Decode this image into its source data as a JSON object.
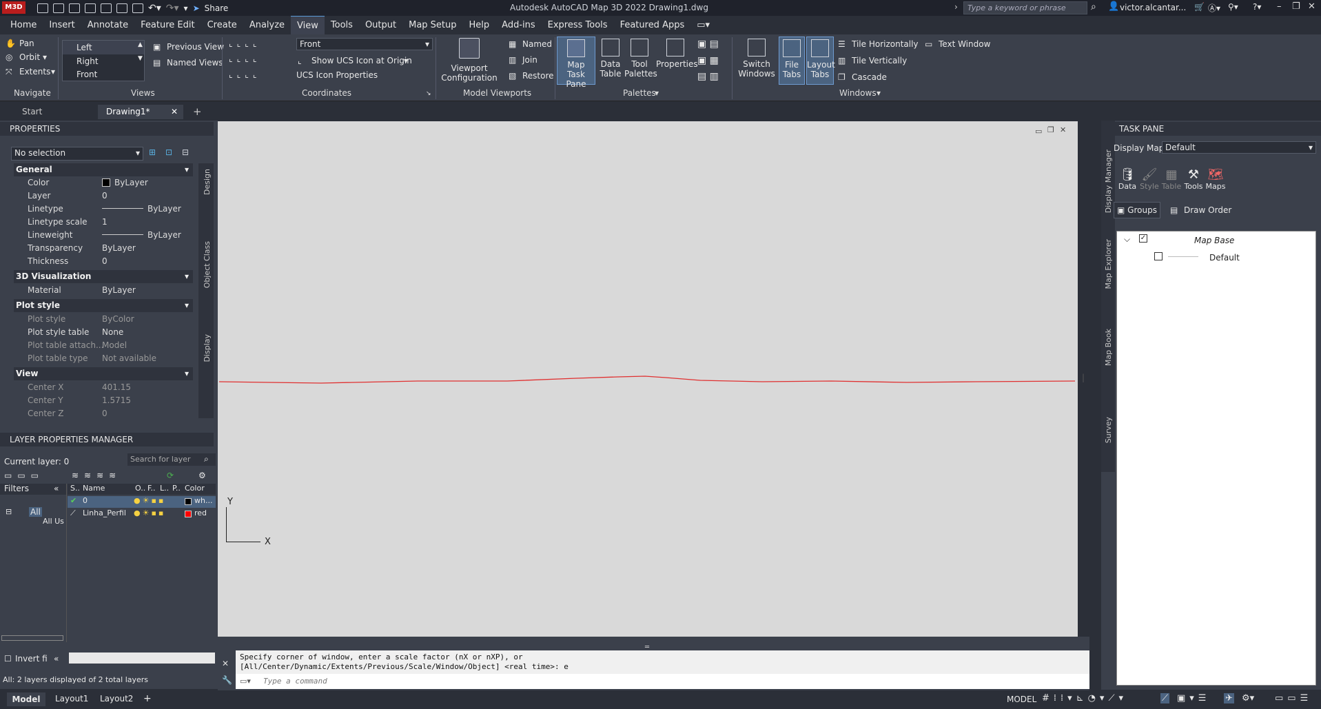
{
  "titlebar": {
    "app_badge": "M3D",
    "share": "Share",
    "title": "Autodesk AutoCAD Map 3D 2022    Drawing1.dwg",
    "search_placeholder": "Type a keyword or phrase",
    "user": "victor.alcantar..."
  },
  "menu": [
    "Home",
    "Insert",
    "Annotate",
    "Feature Edit",
    "Create",
    "Analyze",
    "View",
    "Tools",
    "Output",
    "Map Setup",
    "Help",
    "Add-ins",
    "Express Tools",
    "Featured Apps"
  ],
  "ribbon": {
    "navigate": {
      "pan": "Pan",
      "orbit": "Orbit",
      "extents": "Extents",
      "label": "Navigate"
    },
    "views": {
      "list": [
        "Left",
        "Right",
        "Front"
      ],
      "previous": "Previous View",
      "named": "Named Views",
      "label": "Views"
    },
    "coordinates": {
      "ucs": "Front",
      "show_ucs": "Show UCS Icon at Origin",
      "ucs_props": "UCS Icon Properties",
      "label": "Coordinates"
    },
    "model_viewports": {
      "config": "Viewport Configuration",
      "named": "Named",
      "join": "Join",
      "restore": "Restore",
      "label": "Model Viewports"
    },
    "palettes": {
      "map_task": "Map Task Pane",
      "data_table": "Data Table",
      "tool_palettes": "Tool Palettes",
      "properties": "Properties",
      "label": "Palettes"
    },
    "windows": {
      "switch": "Switch Windows",
      "file_tabs": "File Tabs",
      "layout_tabs": "Layout Tabs",
      "tile_h": "Tile Horizontally",
      "tile_v": "Tile Vertically",
      "cascade": "Cascade",
      "text_window": "Text Window",
      "label": "Windows"
    }
  },
  "doctabs": {
    "start": "Start",
    "drawing": "Drawing1*"
  },
  "properties": {
    "header": "PROPERTIES",
    "selection": "No selection",
    "general": {
      "label": "General",
      "rows": [
        [
          "Color",
          "ByLayer"
        ],
        [
          "Layer",
          "0"
        ],
        [
          "Linetype",
          "ByLayer"
        ],
        [
          "Linetype scale",
          "1"
        ],
        [
          "Lineweight",
          "ByLayer"
        ],
        [
          "Transparency",
          "ByLayer"
        ],
        [
          "Thickness",
          "0"
        ]
      ]
    },
    "viz": {
      "label": "3D Visualization",
      "rows": [
        [
          "Material",
          "ByLayer"
        ]
      ]
    },
    "plot": {
      "label": "Plot style",
      "rows": [
        [
          "Plot style",
          "ByColor"
        ],
        [
          "Plot style table",
          "None"
        ],
        [
          "Plot table attach...",
          "Model"
        ],
        [
          "Plot table type",
          "Not available"
        ]
      ]
    },
    "view": {
      "label": "View",
      "rows": [
        [
          "Center X",
          "401.15"
        ],
        [
          "Center Y",
          "1.5715"
        ],
        [
          "Center Z",
          "0"
        ]
      ]
    },
    "side_tabs": [
      "Design",
      "Object Class",
      "Display"
    ]
  },
  "layers": {
    "header": "LAYER PROPERTIES MANAGER",
    "current": "Current layer: 0",
    "search": "Search for layer",
    "filters": "Filters",
    "all": "All",
    "all_used": "All Us",
    "cols": [
      "S..",
      "Name",
      "O..",
      "F..",
      "L..",
      "P..",
      "Color"
    ],
    "rows": [
      {
        "name": "0",
        "color": "wh...",
        "swatch": "#000000"
      },
      {
        "name": "Linha_Perfil",
        "color": "red",
        "swatch": "#ff0000"
      }
    ],
    "invert": "Invert fi",
    "footer": "All: 2 layers displayed of 2 total layers"
  },
  "canvas": {
    "axis_y": "Y",
    "axis_x": "X",
    "line_color": "#e03030"
  },
  "command": {
    "line1": "Specify corner of window, enter a scale factor (nX or nXP), or",
    "line2": "[All/Center/Dynamic/Extents/Previous/Scale/Window/Object] <real time>: e",
    "placeholder": "Type a command"
  },
  "status": {
    "tabs": [
      "Model",
      "Layout1",
      "Layout2"
    ],
    "model": "MODEL"
  },
  "taskpane": {
    "header": "TASK PANE",
    "display_map_label": "Display Map:",
    "display_map": "Default",
    "tools": [
      "Data",
      "Style",
      "Table",
      "Tools",
      "Maps"
    ],
    "groups": "Groups",
    "draw_order": "Draw Order",
    "tree": {
      "root": "Map Base",
      "child": "Default"
    },
    "side_tabs": [
      "Display Manager",
      "Map Explorer",
      "Map Book",
      "Survey"
    ]
  }
}
